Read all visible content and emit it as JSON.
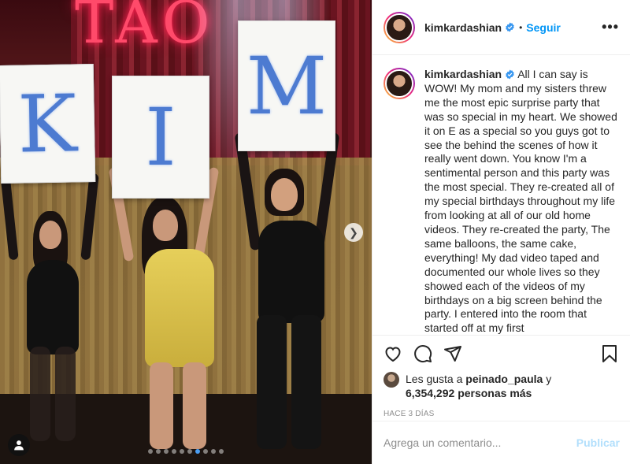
{
  "post": {
    "photo": {
      "neon_sign": "TAO",
      "sign_letters": [
        "K",
        "I",
        "M"
      ],
      "carousel": {
        "count": 10,
        "active_index": 6
      }
    },
    "header": {
      "username": "kimkardashian",
      "verified": true,
      "bullet": "•",
      "follow_label": "Seguir",
      "more_label": "•••"
    },
    "caption": {
      "username": "kimkardashian",
      "text": "All I can say is WOW! My mom and my sisters threw me the most epic surprise party that was so special in my heart. We showed it on E as a special so you guys got to see the behind the scenes of how it really went down. You know I'm a sentimental person and this party was the most special. They re-created all of my special birthdays throughout my life from looking at all of our old home videos. They re-created the party, The same balloons, the same cake, everything! My dad video taped and documented our whole lives so they showed each of the videos of my birthdays on a big screen behind the party. I entered into the room that started off at my first"
    },
    "actions": {
      "like_icon": "heart-icon",
      "comment_icon": "comment-icon",
      "share_icon": "paper-plane-icon",
      "save_icon": "bookmark-icon"
    },
    "likes": {
      "prefix": "Les gusta a",
      "liker": "peinado_paula",
      "conj": "y",
      "count": "6,354,292",
      "suffix": "personas más"
    },
    "timestamp": "HACE 3 DÍAS",
    "comment": {
      "placeholder": "Agrega un comentario...",
      "publish_label": "Publicar"
    },
    "colors": {
      "accent": "#0095f6",
      "publish_disabled": "#b2dffc",
      "sign_letter": "#4d7bd1"
    }
  }
}
